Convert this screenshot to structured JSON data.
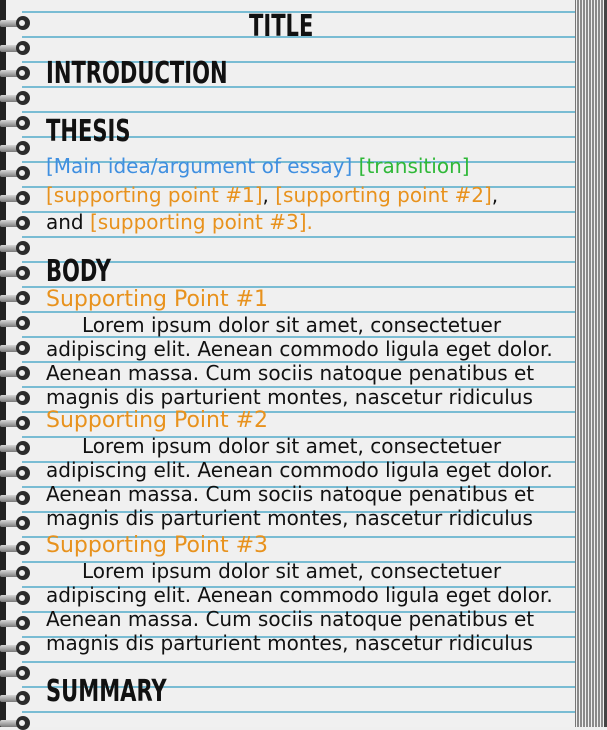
{
  "document": {
    "title": "TITLE",
    "sections": {
      "introduction": "INTRODUCTION",
      "thesis": "THESIS",
      "body": "BODY",
      "summary": "SUMMARY"
    },
    "thesis_text": {
      "main_idea": "[Main idea/argument of essay]",
      "transition": "[transition]",
      "point1": "[supporting point #1]",
      "comma1": ",",
      "point2": "[supporting point #2]",
      "comma2": ",",
      "and": "and",
      "point3": "[supporting point #3]."
    },
    "body_points": [
      {
        "heading": "Supporting Point #1",
        "lines": [
          "Lorem ipsum dolor sit amet, consectetuer",
          "adipiscing elit. Aenean commodo ligula eget dolor.",
          "Aenean massa. Cum sociis natoque penatibus et",
          "magnis dis parturient montes, nascetur ridiculus"
        ]
      },
      {
        "heading": "Supporting Point #2",
        "lines": [
          "Lorem ipsum dolor sit amet, consectetuer",
          "adipiscing elit. Aenean commodo ligula eget dolor.",
          "Aenean massa. Cum sociis natoque penatibus et",
          "magnis dis parturient montes, nascetur ridiculus"
        ]
      },
      {
        "heading": "Supporting Point #3",
        "lines": [
          "Lorem ipsum dolor sit amet, consectetuer",
          "adipiscing elit. Aenean commodo ligula eget dolor.",
          "Aenean massa. Cum sociis natoque penatibus et",
          "magnis dis parturient montes, nascetur ridiculus"
        ]
      }
    ]
  },
  "colors": {
    "main_idea": "#3f8fe0",
    "transition": "#2fb838",
    "supporting_point": "#e8921d",
    "rule_line": "#79bcd3"
  }
}
